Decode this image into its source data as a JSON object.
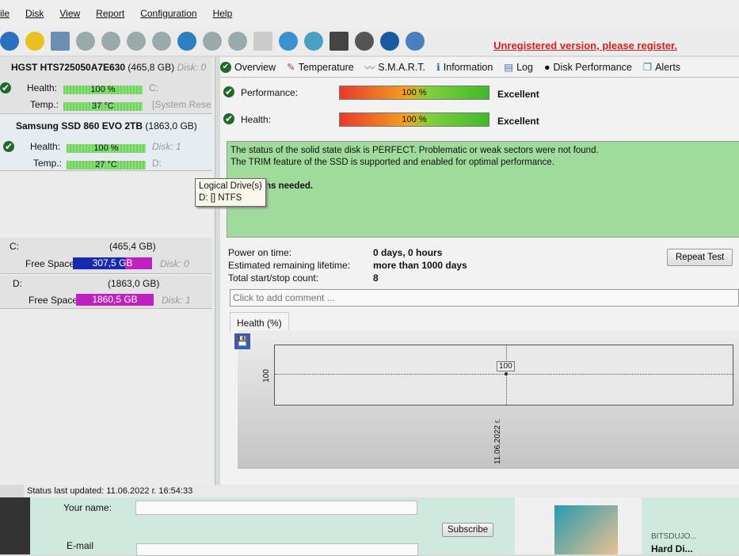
{
  "menu": [
    "ile",
    "Disk",
    "View",
    "Report",
    "Configuration",
    "Help"
  ],
  "unregistered": "Unregistered version, please register.",
  "disks": [
    {
      "name": "HGST HTS725050A7E630",
      "size": "(465,8 GB)",
      "disk": "Disk: 0",
      "health": "100 %",
      "temp": "37 °C",
      "drive": "C:",
      "extra": "[System Rese"
    },
    {
      "name": "Samsung SSD 860 EVO 2TB",
      "size": "(1863,0 GB)",
      "disk": "Disk: 1",
      "health": "100 %",
      "temp": "27 °C",
      "drive": "D:"
    }
  ],
  "labels": {
    "health": "Health:",
    "temp": "Temp.:",
    "free": "Free Space"
  },
  "volumes": [
    {
      "letter": "C:",
      "size": "(465,4 GB)",
      "free": "307,5 GB",
      "disk": "Disk: 0",
      "free_fraction": 0.66
    },
    {
      "letter": "D:",
      "size": "(1863,0 GB)",
      "free": "1860,5 GB",
      "disk": "Disk: 1",
      "free_fraction": 0.999
    }
  ],
  "tooltip": {
    "title": "Logical Drive(s)",
    "line": "D: [] NTFS"
  },
  "tabs": [
    "Overview",
    "Temperature",
    "S.M.A.R.T.",
    "Information",
    "Log",
    "Disk Performance",
    "Alerts"
  ],
  "overview": {
    "performance_label": "Performance:",
    "performance_value": "100 %",
    "performance_rating": "Excellent",
    "health_label": "Health:",
    "health_value": "100 %",
    "health_rating": "Excellent",
    "status_line1": "The status of the solid state disk is PERFECT. Problematic or weak sectors were not found.",
    "status_line2": "The TRIM feature of the SSD is supported and enabled for optimal performance.",
    "status_line3": "ns needed.",
    "power_on_label": "Power on time:",
    "power_on_value": "0 days, 0 hours",
    "lifetime_label": "Estimated remaining lifetime:",
    "lifetime_value": "more than 1000 days",
    "startstop_label": "Total start/stop count:",
    "startstop_value": "8",
    "repeat_test": "Repeat Test",
    "comment_placeholder": "Click to add comment ..."
  },
  "chart_data": {
    "type": "line",
    "title": "Health (%)",
    "x": [
      "11.06.2022 г."
    ],
    "values": [
      100
    ],
    "ytick": "100",
    "label": "100"
  },
  "statusbar": "Status last updated: 11.06.2022 г. 16:54:33",
  "web": {
    "name_label": "Your name:",
    "email_label": "E-mail",
    "subscribe": "Subscribe",
    "brand": "BITSDUJO...",
    "product": "Hard Di..."
  }
}
